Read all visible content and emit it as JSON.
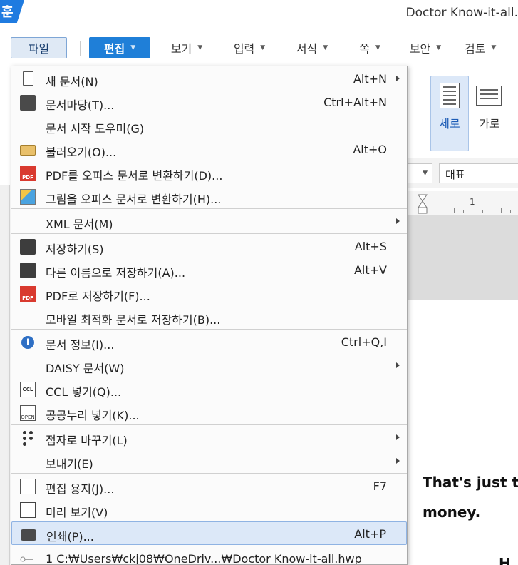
{
  "window": {
    "app_logo": "훈",
    "document_title": "Doctor Know-it-all."
  },
  "menubar": {
    "items": [
      {
        "label": "파일"
      },
      {
        "label": "편집"
      },
      {
        "label": "보기"
      },
      {
        "label": "입력"
      },
      {
        "label": "서식"
      },
      {
        "label": "쪽"
      },
      {
        "label": "보안"
      },
      {
        "label": "검토"
      }
    ]
  },
  "ribbon": {
    "portrait_label": "세로",
    "landscape_label": "가로"
  },
  "toolbar": {
    "style_value": "대표"
  },
  "ruler": {
    "number": "1"
  },
  "document": {
    "line1": "That's just t",
    "line2": "money.",
    "line3": "H"
  },
  "file_menu": {
    "items": [
      {
        "label": "새 문서(N)",
        "shortcut": "Alt+N",
        "icon": "new-document-icon",
        "submenu": true
      },
      {
        "label": "문서마당(T)...",
        "shortcut": "Ctrl+Alt+N",
        "icon": "template-icon"
      },
      {
        "label": "문서 시작 도우미(G)",
        "shortcut": "",
        "icon": ""
      },
      {
        "label": "불러오기(O)...",
        "shortcut": "Alt+O",
        "icon": "open-folder-icon"
      },
      {
        "label": "PDF를 오피스 문서로 변환하기(D)...",
        "shortcut": "",
        "icon": "pdf-convert-icon"
      },
      {
        "label": "그림을 오피스 문서로 변환하기(H)...",
        "shortcut": "",
        "icon": "image-convert-icon"
      },
      {
        "label": "XML 문서(M)",
        "shortcut": "",
        "icon": "",
        "submenu": true
      },
      {
        "label": "저장하기(S)",
        "shortcut": "Alt+S",
        "icon": "save-icon"
      },
      {
        "label": "다른 이름으로 저장하기(A)...",
        "shortcut": "Alt+V",
        "icon": "save-as-icon"
      },
      {
        "label": "PDF로 저장하기(F)...",
        "shortcut": "",
        "icon": "pdf-save-icon"
      },
      {
        "label": "모바일 최적화 문서로 저장하기(B)...",
        "shortcut": "",
        "icon": ""
      },
      {
        "label": "문서 정보(I)...",
        "shortcut": "Ctrl+Q,I",
        "icon": "info-icon"
      },
      {
        "label": "DAISY 문서(W)",
        "shortcut": "",
        "icon": "",
        "submenu": true
      },
      {
        "label": "CCL 넣기(Q)...",
        "shortcut": "",
        "icon": "ccl-icon"
      },
      {
        "label": "공공누리 넣기(K)...",
        "shortcut": "",
        "icon": "kogl-icon"
      },
      {
        "label": "점자로 바꾸기(L)",
        "shortcut": "",
        "icon": "braille-icon",
        "submenu": true
      },
      {
        "label": "보내기(E)",
        "shortcut": "",
        "icon": "",
        "submenu": true
      },
      {
        "label": "편집 용지(J)...",
        "shortcut": "F7",
        "icon": "page-setup-icon"
      },
      {
        "label": "미리 보기(V)",
        "shortcut": "",
        "icon": "preview-icon"
      },
      {
        "label": "인쇄(P)...",
        "shortcut": "Alt+P",
        "icon": "print-icon",
        "highlighted": true
      },
      {
        "label": "1 C:₩Users₩ckj08₩OneDriv...₩Doctor Know-it-all.hwp",
        "shortcut": "",
        "icon": "recent-file-key-icon"
      }
    ]
  },
  "colors": {
    "accent": "#1f7fd8",
    "hover_bg": "#dce8f8",
    "hover_border": "#8fb3e3"
  }
}
